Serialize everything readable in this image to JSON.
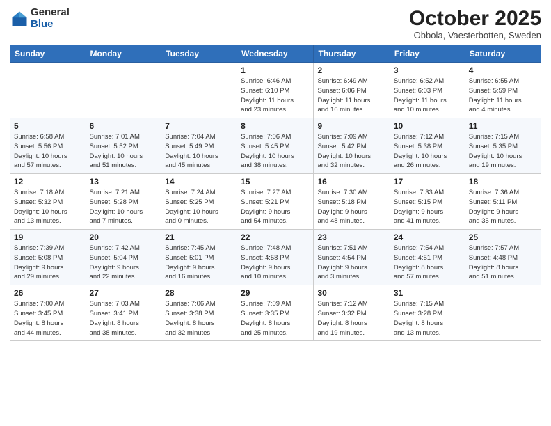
{
  "logo": {
    "general": "General",
    "blue": "Blue"
  },
  "header": {
    "month": "October 2025",
    "location": "Obbola, Vaesterbotten, Sweden"
  },
  "weekdays": [
    "Sunday",
    "Monday",
    "Tuesday",
    "Wednesday",
    "Thursday",
    "Friday",
    "Saturday"
  ],
  "weeks": [
    [
      {
        "day": "",
        "info": ""
      },
      {
        "day": "",
        "info": ""
      },
      {
        "day": "",
        "info": ""
      },
      {
        "day": "1",
        "info": "Sunrise: 6:46 AM\nSunset: 6:10 PM\nDaylight: 11 hours\nand 23 minutes."
      },
      {
        "day": "2",
        "info": "Sunrise: 6:49 AM\nSunset: 6:06 PM\nDaylight: 11 hours\nand 16 minutes."
      },
      {
        "day": "3",
        "info": "Sunrise: 6:52 AM\nSunset: 6:03 PM\nDaylight: 11 hours\nand 10 minutes."
      },
      {
        "day": "4",
        "info": "Sunrise: 6:55 AM\nSunset: 5:59 PM\nDaylight: 11 hours\nand 4 minutes."
      }
    ],
    [
      {
        "day": "5",
        "info": "Sunrise: 6:58 AM\nSunset: 5:56 PM\nDaylight: 10 hours\nand 57 minutes."
      },
      {
        "day": "6",
        "info": "Sunrise: 7:01 AM\nSunset: 5:52 PM\nDaylight: 10 hours\nand 51 minutes."
      },
      {
        "day": "7",
        "info": "Sunrise: 7:04 AM\nSunset: 5:49 PM\nDaylight: 10 hours\nand 45 minutes."
      },
      {
        "day": "8",
        "info": "Sunrise: 7:06 AM\nSunset: 5:45 PM\nDaylight: 10 hours\nand 38 minutes."
      },
      {
        "day": "9",
        "info": "Sunrise: 7:09 AM\nSunset: 5:42 PM\nDaylight: 10 hours\nand 32 minutes."
      },
      {
        "day": "10",
        "info": "Sunrise: 7:12 AM\nSunset: 5:38 PM\nDaylight: 10 hours\nand 26 minutes."
      },
      {
        "day": "11",
        "info": "Sunrise: 7:15 AM\nSunset: 5:35 PM\nDaylight: 10 hours\nand 19 minutes."
      }
    ],
    [
      {
        "day": "12",
        "info": "Sunrise: 7:18 AM\nSunset: 5:32 PM\nDaylight: 10 hours\nand 13 minutes."
      },
      {
        "day": "13",
        "info": "Sunrise: 7:21 AM\nSunset: 5:28 PM\nDaylight: 10 hours\nand 7 minutes."
      },
      {
        "day": "14",
        "info": "Sunrise: 7:24 AM\nSunset: 5:25 PM\nDaylight: 10 hours\nand 0 minutes."
      },
      {
        "day": "15",
        "info": "Sunrise: 7:27 AM\nSunset: 5:21 PM\nDaylight: 9 hours\nand 54 minutes."
      },
      {
        "day": "16",
        "info": "Sunrise: 7:30 AM\nSunset: 5:18 PM\nDaylight: 9 hours\nand 48 minutes."
      },
      {
        "day": "17",
        "info": "Sunrise: 7:33 AM\nSunset: 5:15 PM\nDaylight: 9 hours\nand 41 minutes."
      },
      {
        "day": "18",
        "info": "Sunrise: 7:36 AM\nSunset: 5:11 PM\nDaylight: 9 hours\nand 35 minutes."
      }
    ],
    [
      {
        "day": "19",
        "info": "Sunrise: 7:39 AM\nSunset: 5:08 PM\nDaylight: 9 hours\nand 29 minutes."
      },
      {
        "day": "20",
        "info": "Sunrise: 7:42 AM\nSunset: 5:04 PM\nDaylight: 9 hours\nand 22 minutes."
      },
      {
        "day": "21",
        "info": "Sunrise: 7:45 AM\nSunset: 5:01 PM\nDaylight: 9 hours\nand 16 minutes."
      },
      {
        "day": "22",
        "info": "Sunrise: 7:48 AM\nSunset: 4:58 PM\nDaylight: 9 hours\nand 10 minutes."
      },
      {
        "day": "23",
        "info": "Sunrise: 7:51 AM\nSunset: 4:54 PM\nDaylight: 9 hours\nand 3 minutes."
      },
      {
        "day": "24",
        "info": "Sunrise: 7:54 AM\nSunset: 4:51 PM\nDaylight: 8 hours\nand 57 minutes."
      },
      {
        "day": "25",
        "info": "Sunrise: 7:57 AM\nSunset: 4:48 PM\nDaylight: 8 hours\nand 51 minutes."
      }
    ],
    [
      {
        "day": "26",
        "info": "Sunrise: 7:00 AM\nSunset: 3:45 PM\nDaylight: 8 hours\nand 44 minutes."
      },
      {
        "day": "27",
        "info": "Sunrise: 7:03 AM\nSunset: 3:41 PM\nDaylight: 8 hours\nand 38 minutes."
      },
      {
        "day": "28",
        "info": "Sunrise: 7:06 AM\nSunset: 3:38 PM\nDaylight: 8 hours\nand 32 minutes."
      },
      {
        "day": "29",
        "info": "Sunrise: 7:09 AM\nSunset: 3:35 PM\nDaylight: 8 hours\nand 25 minutes."
      },
      {
        "day": "30",
        "info": "Sunrise: 7:12 AM\nSunset: 3:32 PM\nDaylight: 8 hours\nand 19 minutes."
      },
      {
        "day": "31",
        "info": "Sunrise: 7:15 AM\nSunset: 3:28 PM\nDaylight: 8 hours\nand 13 minutes."
      },
      {
        "day": "",
        "info": ""
      }
    ]
  ]
}
